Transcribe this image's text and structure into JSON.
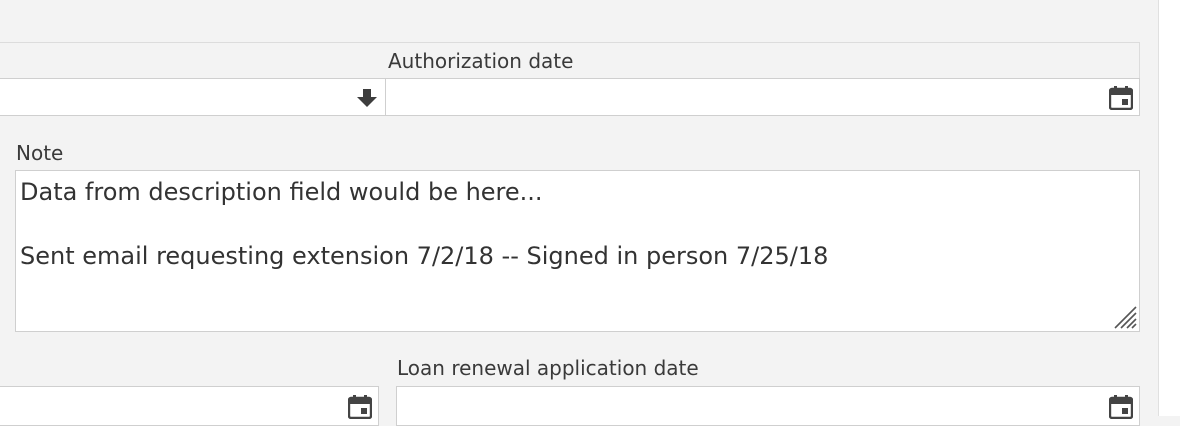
{
  "authorization": {
    "label": "Authorization date",
    "value": ""
  },
  "select": {
    "value": "",
    "icon": "arrow-down-icon"
  },
  "note": {
    "label": "Note",
    "line1": "Data from description field would be here...",
    "line2": "Sent email requesting extension 7/2/18 -- Signed in person 7/25/18"
  },
  "loan_renewal": {
    "label": "Loan renewal application date",
    "value": ""
  },
  "icons": {
    "calendar": "calendar-icon",
    "resize": "resize-handle-icon"
  },
  "colors": {
    "background": "#f3f3f3",
    "field": "#ffffff",
    "border": "#cfcfcf",
    "text": "#333333",
    "icon": "#444444"
  }
}
